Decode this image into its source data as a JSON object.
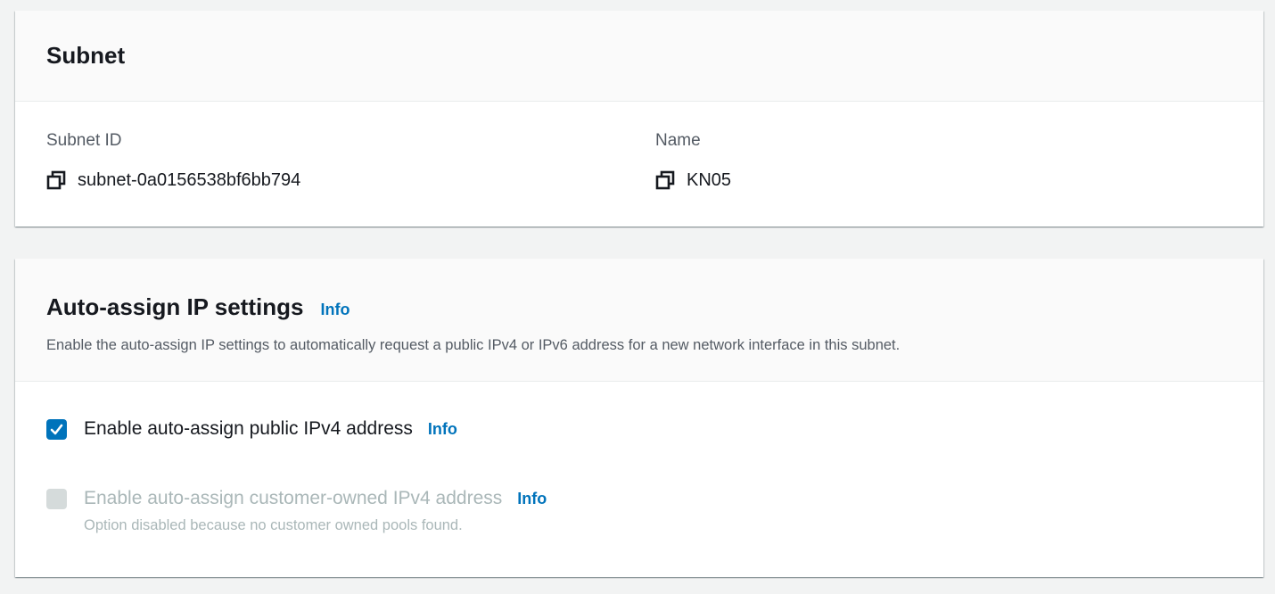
{
  "subnet": {
    "title": "Subnet",
    "subnet_id_label": "Subnet ID",
    "subnet_id_value": "subnet-0a0156538bf6bb794",
    "name_label": "Name",
    "name_value": "KN05"
  },
  "auto_assign": {
    "title": "Auto-assign IP settings",
    "info_label": "Info",
    "description": "Enable the auto-assign IP settings to automatically request a public IPv4 or IPv6 address for a new network interface in this subnet.",
    "options": [
      {
        "label": "Enable auto-assign public IPv4 address",
        "info_label": "Info",
        "checked": true,
        "disabled": false
      },
      {
        "label": "Enable auto-assign customer-owned IPv4 address",
        "info_label": "Info",
        "checked": false,
        "disabled": true,
        "helper": "Option disabled because no customer owned pools found."
      }
    ]
  },
  "colors": {
    "accent": "#0073bb",
    "page_bg": "#f2f3f3",
    "header_bg": "#fafafa",
    "disabled": "#d5dbdb"
  }
}
